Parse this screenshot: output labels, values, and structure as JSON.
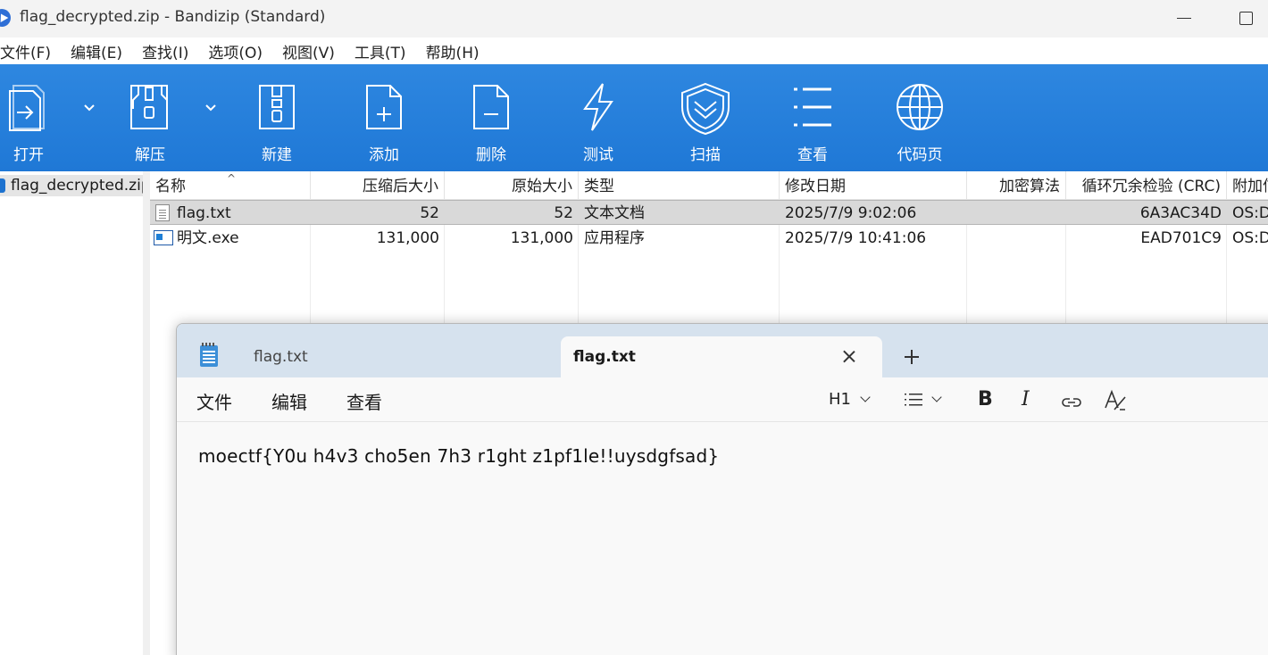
{
  "window": {
    "title": "flag_decrypted.zip - Bandizip (Standard)"
  },
  "menu": [
    "文件(F)",
    "编辑(E)",
    "查找(I)",
    "选项(O)",
    "视图(V)",
    "工具(T)",
    "帮助(H)"
  ],
  "toolbar": {
    "open": "打开",
    "extract": "解压",
    "new": "新建",
    "add": "添加",
    "delete": "删除",
    "test": "测试",
    "scan": "扫描",
    "view": "查看",
    "codepage": "代码页"
  },
  "tree": {
    "archive": "flag_decrypted.zip"
  },
  "columns": {
    "name": "名称",
    "compressed": "压缩后大小",
    "original": "原始大小",
    "type": "类型",
    "modified": "修改日期",
    "encryption": "加密算法",
    "crc": "循环冗余检验 (CRC)",
    "extra": "附加信息"
  },
  "files": [
    {
      "name": "flag.txt",
      "compressed": "52",
      "original": "52",
      "type": "文本文档",
      "modified": "2025/7/9 9:02:06",
      "encryption": "",
      "crc": "6A3AC34D",
      "extra": "OS:DOS"
    },
    {
      "name": "明文.exe",
      "compressed": "131,000",
      "original": "131,000",
      "type": "应用程序",
      "modified": "2025/7/9 10:41:06",
      "encryption": "",
      "crc": "EAD701C9",
      "extra": "OS:DOS"
    }
  ],
  "notepad": {
    "tabs": [
      "flag.txt",
      "flag.txt"
    ],
    "menu": [
      "文件",
      "编辑",
      "查看"
    ],
    "heading": "H1",
    "content": "moectf{Y0u h4v3 cho5en 7h3 r1ght z1pf1le!!uysdgfsad}"
  },
  "colors": {
    "toolbar": "#1f78d6",
    "selection": "#d9d9d9",
    "notepad_tabbar": "#d6e2ee"
  }
}
